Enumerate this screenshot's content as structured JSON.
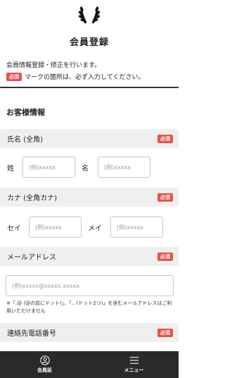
{
  "header": {
    "title": "会員登録"
  },
  "intro": {
    "line1": "会員情報登録・修正を行います。",
    "required_badge": "必須",
    "line2": "マークの箇所は、必ず入力してください。"
  },
  "section": {
    "title": "お客様情報"
  },
  "fields": {
    "name": {
      "label": "氏名 (全角)",
      "badge": "必須",
      "sei_label": "姓",
      "sei_placeholder": "(例)xxxxx",
      "mei_label": "名",
      "mei_placeholder": "(例)xxxxx"
    },
    "kana": {
      "label": "カナ (全角カナ)",
      "badge": "必須",
      "sei_label": "セイ",
      "sei_placeholder": "(例)xxxxx",
      "mei_label": "メイ",
      "mei_placeholder": "(例)xxxxx"
    },
    "email": {
      "label": "メールアドレス",
      "badge": "必須",
      "placeholder": "(例)xxxxx@xxxxx.xxxxx",
      "note": "※「.@ (@の前にドット)」、「.. (ドット2つ)」を含むメールアドレスはご利用いただけません"
    },
    "phone": {
      "label": "連絡先電話番号",
      "badge": "必須"
    }
  },
  "bottom_nav": {
    "member_card": {
      "label": "会員証",
      "icon": "user-circle-icon"
    },
    "menu": {
      "label": "メニュー",
      "icon": "hamburger-menu-icon"
    }
  },
  "colors": {
    "badge": "#e8524a",
    "nav_bg": "#2a2a2a",
    "field_bar": "#efefef"
  }
}
